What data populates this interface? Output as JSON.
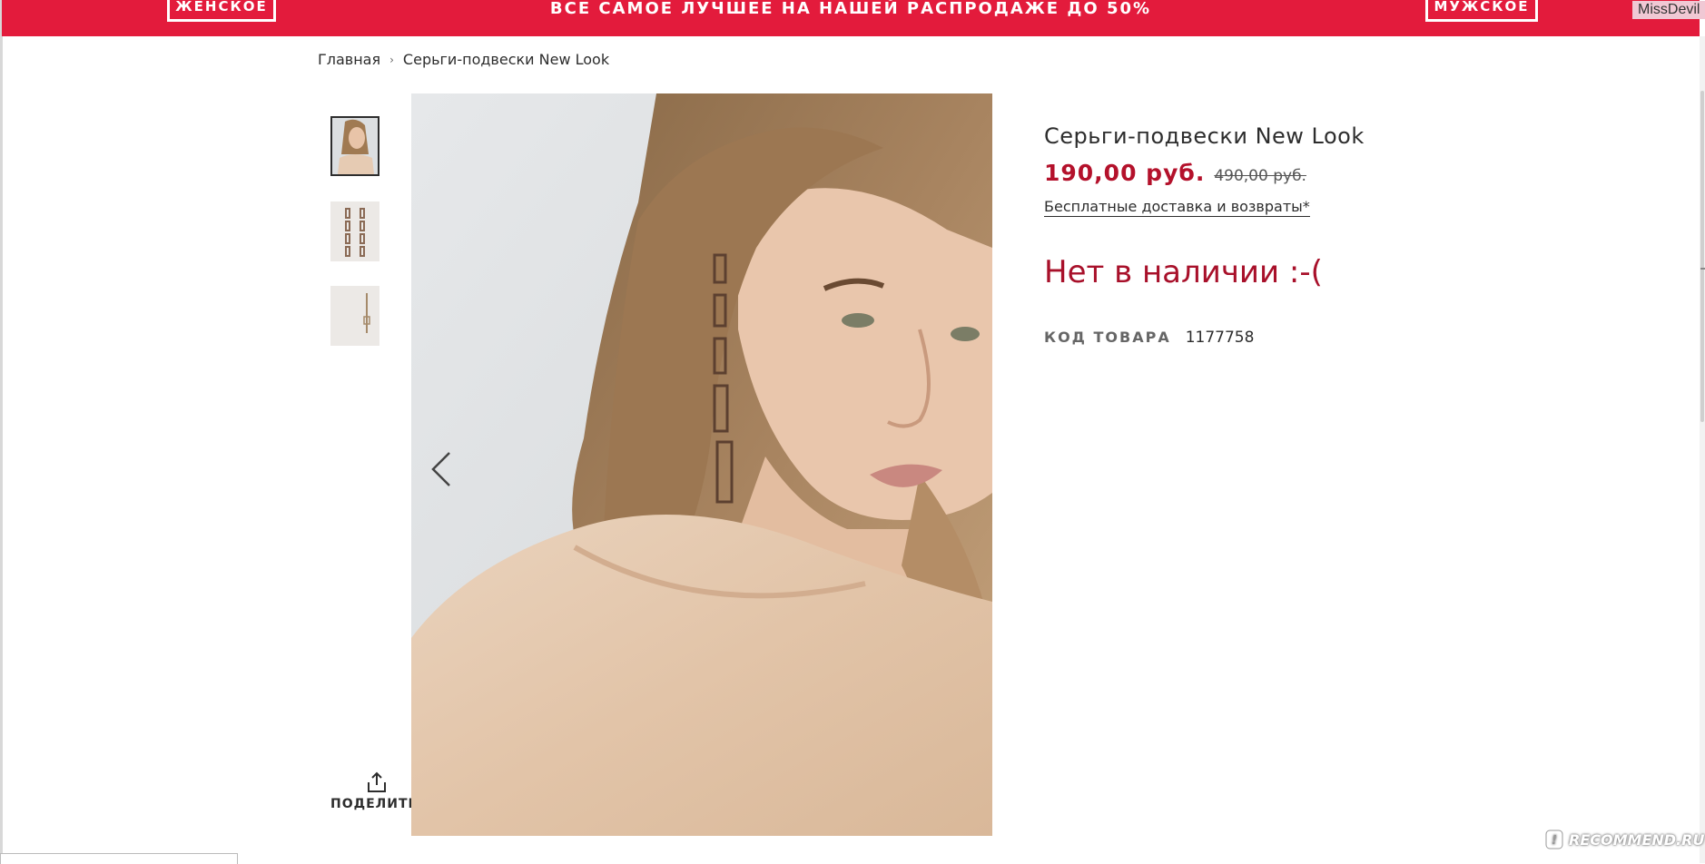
{
  "promo": {
    "women_button": "ЖЕНСКОЕ",
    "headline": "ВСЕ САМОЕ ЛУЧШЕЕ НА НАШЕЙ РАСПРОДАЖЕ ДО 50%",
    "men_button": "МУЖСКОЕ",
    "user_tag": "MissDevil",
    "background_color": "#e31b3c"
  },
  "breadcrumb": {
    "home": "Главная",
    "current": "Серьги-подвески New Look"
  },
  "gallery": {
    "thumbnails": [
      "model-photo",
      "earrings-photo",
      "earring-detail-photo"
    ],
    "active_index": 0
  },
  "share": {
    "label": "ПОДЕЛИТЬС"
  },
  "product": {
    "title": "Серьги-подвески New Look",
    "price_current": "190,00 руб.",
    "price_old": "490,00 руб.",
    "delivery_link": "Бесплатные доставка и возвраты*",
    "stock_status": "Нет в наличии :-(",
    "code_label": "КОД ТОВАРА",
    "code_value": "1177758",
    "accent_color": "#b4112b"
  },
  "watermark": {
    "text": "RECOMMEND.RU"
  }
}
